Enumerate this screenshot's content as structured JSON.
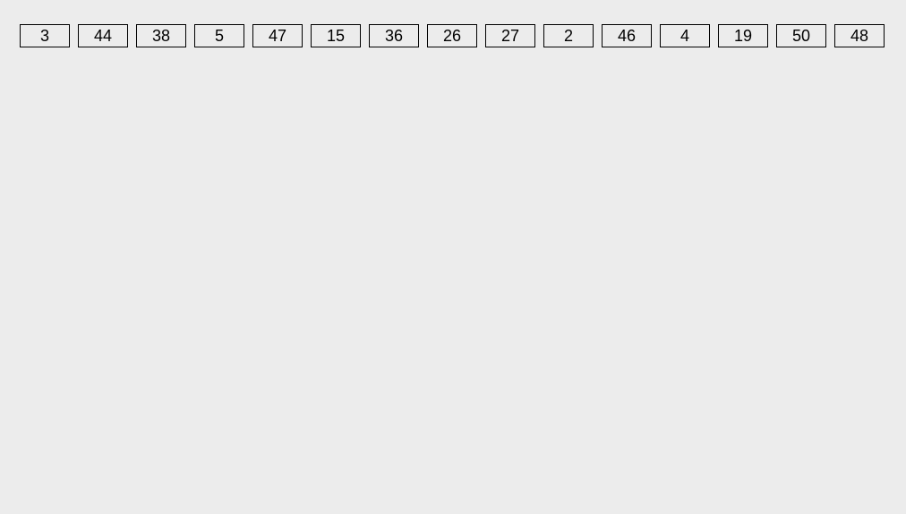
{
  "buttons": {
    "items": [
      {
        "label": "3"
      },
      {
        "label": "44"
      },
      {
        "label": "38"
      },
      {
        "label": "5"
      },
      {
        "label": "47"
      },
      {
        "label": "15"
      },
      {
        "label": "36"
      },
      {
        "label": "26"
      },
      {
        "label": "27"
      },
      {
        "label": "2"
      },
      {
        "label": "46"
      },
      {
        "label": "4"
      },
      {
        "label": "19"
      },
      {
        "label": "50"
      },
      {
        "label": "48"
      }
    ]
  }
}
